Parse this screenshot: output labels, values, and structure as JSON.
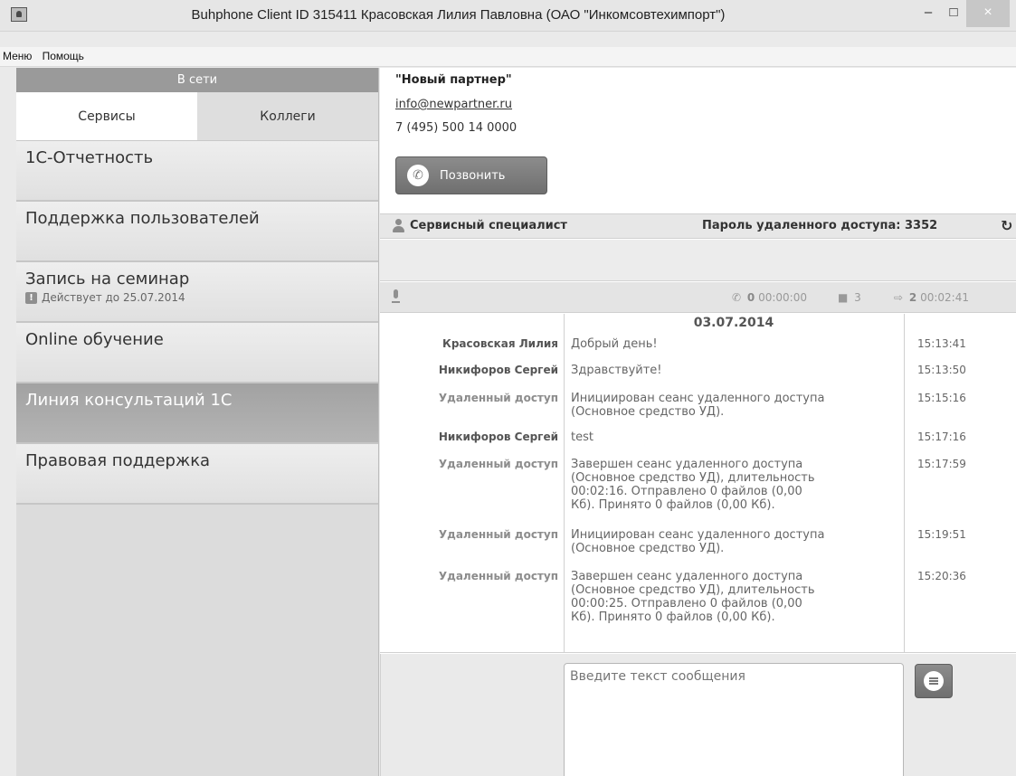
{
  "window": {
    "title": "Buhphone Client ID 315411 Красовская Лилия Павловна (ОАО \"Инкомсовтехимпорт\")",
    "minimize_glyph": "–",
    "maximize_glyph": "□",
    "close_glyph": "×"
  },
  "menu": {
    "items": [
      "Меню",
      "Помощь"
    ]
  },
  "sidebar": {
    "status": "В сети",
    "tabs": [
      {
        "label": "Сервисы",
        "active": true
      },
      {
        "label": "Коллеги",
        "active": false
      }
    ],
    "services": [
      {
        "title": "1С-Отчетность",
        "subtitle": ""
      },
      {
        "title": "Поддержка пользователей",
        "subtitle": ""
      },
      {
        "title": "Запись на семинар",
        "subtitle": "Действует до 25.07.2014",
        "warn_glyph": "!"
      },
      {
        "title": "Online обучение",
        "subtitle": ""
      },
      {
        "title": "Линия консультаций 1С",
        "subtitle": "",
        "selected": true
      },
      {
        "title": "Правовая поддержка",
        "subtitle": ""
      }
    ]
  },
  "contact": {
    "name": "\"Новый партнер\"",
    "email": "info@newpartner.ru",
    "phone": "7 (495) 500 14 0000",
    "call_label": "Позвонить"
  },
  "specialist": {
    "label": "Сервисный специалист",
    "password": "Пароль удаленного доступа: 3352"
  },
  "stats": {
    "calls": "0",
    "call_time": "00:00:00",
    "messages": "3",
    "remote": "2",
    "remote_time": "00:02:41"
  },
  "chat": {
    "date": "03.07.2014",
    "messages": [
      {
        "author": "Красовская Лилия",
        "text": "Добрый день!",
        "time": "15:13:41",
        "system": false
      },
      {
        "author": "Никифоров Сергей",
        "text": "Здравствуйте!",
        "time": "15:13:50",
        "system": false
      },
      {
        "author": "Удаленный доступ",
        "text": "Инициирован сеанс удаленного доступа\n(Основное средство УД).",
        "time": "15:15:16",
        "system": true
      },
      {
        "author": "Никифоров Сергей",
        "text": "test",
        "time": "15:17:16",
        "system": false
      },
      {
        "author": "Удаленный доступ",
        "text": "Завершен сеанс удаленного доступа\n(Основное средство УД), длительность\n00:02:16.  Отправлено 0 файлов (0,00\nКб). Принято 0 файлов (0,00 Кб).",
        "time": "15:17:59",
        "system": true
      },
      {
        "author": "Удаленный доступ",
        "text": "Инициирован сеанс удаленного доступа\n(Основное средство УД).",
        "time": "15:19:51",
        "system": true
      },
      {
        "author": "Удаленный доступ",
        "text": "Завершен сеанс удаленного доступа\n(Основное средство УД), длительность\n00:00:25.  Отправлено 0 файлов (0,00\nКб). Принято 0 файлов (0,00 Кб).",
        "time": "15:20:36",
        "system": true
      }
    ]
  },
  "compose": {
    "placeholder": "Введите текст сообщения"
  }
}
